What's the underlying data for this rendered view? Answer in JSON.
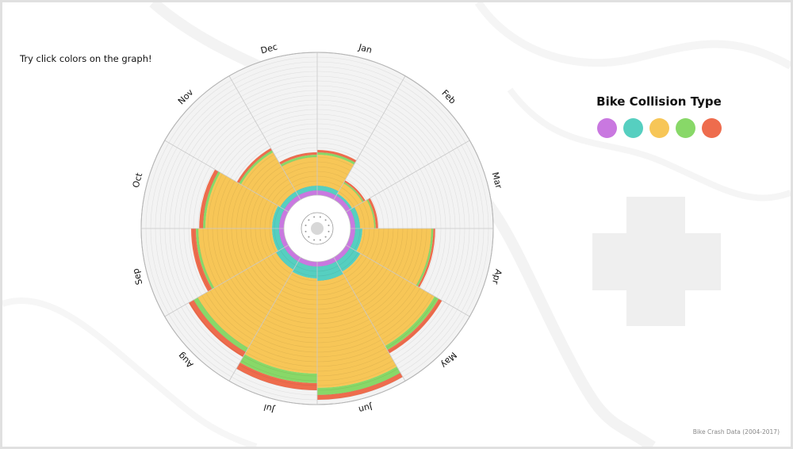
{
  "hint_text": "Try click colors on the graph!",
  "legend": {
    "title": "Bike Collision Type",
    "colors": [
      "#c978e0",
      "#56cfc0",
      "#f7c657",
      "#88d868",
      "#ee6c4d"
    ]
  },
  "footer": "Bike Crash Data (2004-2017)",
  "chart_data": {
    "type": "stacked-polar-bar",
    "categories": [
      "Jan",
      "Feb",
      "Mar",
      "Apr",
      "May",
      "Jun",
      "Jul",
      "Aug",
      "Sep",
      "Oct",
      "Nov",
      "Dec"
    ],
    "series": [
      {
        "color": "#c978e0",
        "values": [
          10,
          10,
          10,
          10,
          10,
          10,
          10,
          10,
          10,
          10,
          10,
          10
        ]
      },
      {
        "color": "#56cfc0",
        "values": [
          10,
          5,
          10,
          15,
          25,
          30,
          25,
          20,
          15,
          15,
          10,
          10
        ]
      },
      {
        "color": "#f7c657",
        "values": [
          65,
          25,
          30,
          145,
          180,
          225,
          200,
          190,
          155,
          140,
          95,
          60
        ]
      },
      {
        "color": "#88d868",
        "values": [
          5,
          3,
          3,
          4,
          10,
          15,
          20,
          10,
          5,
          5,
          5,
          5
        ]
      },
      {
        "color": "#ee6c4d",
        "values": [
          5,
          4,
          5,
          4,
          8,
          10,
          15,
          12,
          10,
          8,
          5,
          5
        ]
      }
    ],
    "rlim": [
      0,
      300
    ]
  }
}
